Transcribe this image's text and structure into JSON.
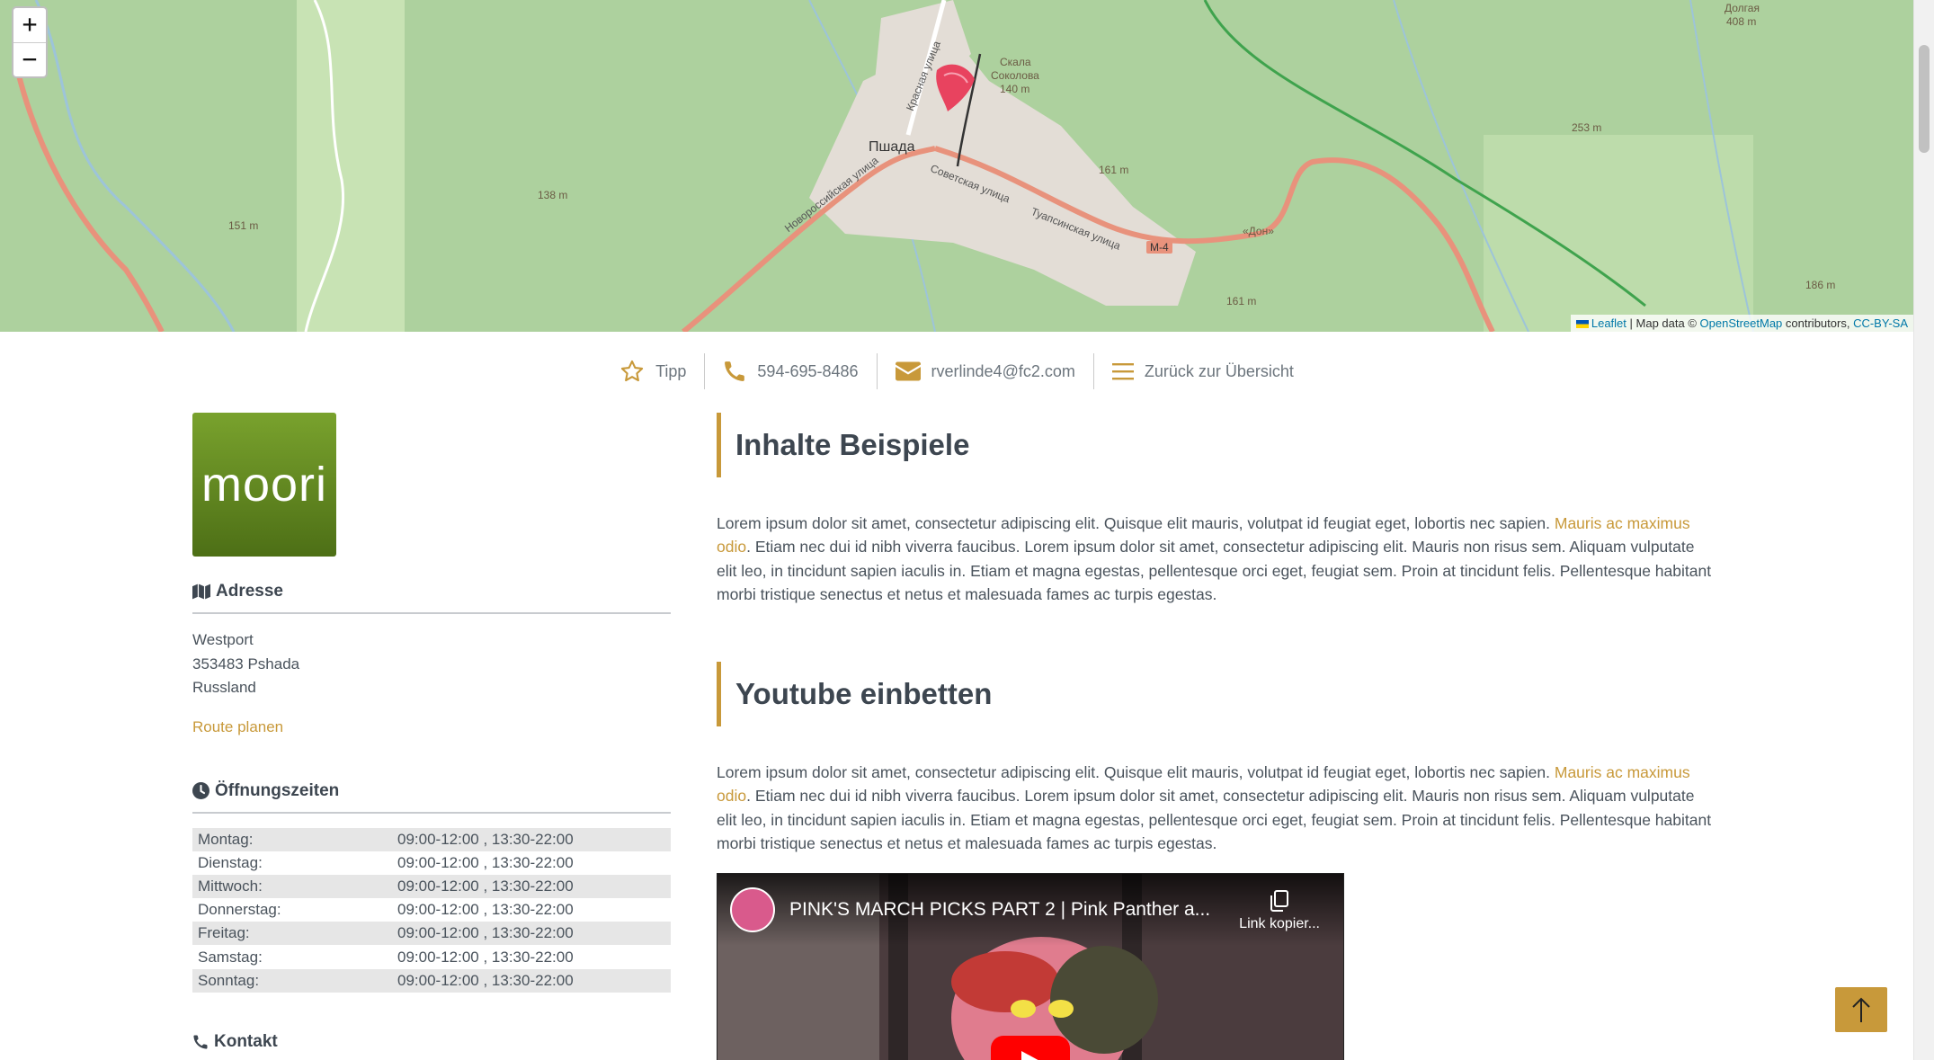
{
  "map": {
    "zoom_in": "+",
    "zoom_out": "−",
    "attribution": {
      "leaflet": "Leaflet",
      "sep": " | Map data © ",
      "osm": "OpenStreetMap",
      "contributors": " contributors, ",
      "license": "CC-BY-SA"
    },
    "labels": {
      "town": "Пшада",
      "rock": "Скала",
      "rock2": "Соколова",
      "rock_h": "140 m",
      "street1": "Новороссийская улица",
      "street2": "Советская улица",
      "street3": "Туапсинская улица",
      "street4": "Красная улица",
      "road": "M-4",
      "don": "«Дон»",
      "h1": "161 m",
      "h2": "138 m",
      "h3": "151 m",
      "h4": "253 m",
      "h5": "186 m",
      "h6": "161 m",
      "h7": "Долгая",
      "h7b": "408 m"
    }
  },
  "nav": {
    "tip": "Tipp",
    "phone": "594-695-8486",
    "email": "rverlinde4@fc2.com",
    "back": "Zurück zur Übersicht"
  },
  "sidebar": {
    "logo_text": "moori",
    "address_heading": "Adresse",
    "address_lines": [
      "Westport",
      "353483 Pshada",
      "Russland"
    ],
    "route_label": "Route planen",
    "hours_heading": "Öffnungszeiten",
    "hours": [
      {
        "day": "Montag:",
        "time": "09:00-12:00 , 13:30-22:00"
      },
      {
        "day": "Dienstag:",
        "time": "09:00-12:00 , 13:30-22:00"
      },
      {
        "day": "Mittwoch:",
        "time": "09:00-12:00 , 13:30-22:00"
      },
      {
        "day": "Donnerstag:",
        "time": "09:00-12:00 , 13:30-22:00"
      },
      {
        "day": "Freitag:",
        "time": "09:00-12:00 , 13:30-22:00"
      },
      {
        "day": "Samstag:",
        "time": "09:00-12:00 , 13:30-22:00"
      },
      {
        "day": "Sonntag:",
        "time": "09:00-12:00 , 13:30-22:00"
      }
    ],
    "contact_heading": "Kontakt"
  },
  "main": {
    "section1_title": "Inhalte Beispiele",
    "section1_text_a": "Lorem ipsum dolor sit amet, consectetur adipiscing elit. Quisque elit mauris, volutpat id feugiat eget, lobortis nec sapien. ",
    "section1_link": "Mauris ac maximus odio",
    "section1_text_b": ". Etiam nec dui id nibh viverra faucibus. Lorem ipsum dolor sit amet, consectetur adipiscing elit. Mauris non risus sem. Aliquam vulputate elit leo, in tincidunt sapien iaculis in. Etiam et magna egestas, pellentesque orci eget, feugiat sem. Proin at tincidunt felis. Pellentesque habitant morbi tristique senectus et netus et malesuada fames ac turpis egestas.",
    "section2_title": "Youtube einbetten",
    "section2_text_a": "Lorem ipsum dolor sit amet, consectetur adipiscing elit. Quisque elit mauris, volutpat id feugiat eget, lobortis nec sapien. ",
    "section2_link": "Mauris ac maximus odio",
    "section2_text_b": ". Etiam nec dui id nibh viverra faucibus. Lorem ipsum dolor sit amet, consectetur adipiscing elit. Mauris non risus sem. Aliquam vulputate elit leo, in tincidunt sapien iaculis in. Etiam et magna egestas, pellentesque orci eget, feugiat sem. Proin at tincidunt felis. Pellentesque habitant morbi tristique senectus et netus et malesuada fames ac turpis egestas.",
    "video": {
      "title": "PINK'S MARCH PICKS PART 2 | Pink Panther a...",
      "copy_label": "Link kopier..."
    }
  },
  "colors": {
    "accent": "#c8993a",
    "map_green": "#a8d596",
    "road": "#e8927c",
    "marker": "#e8435f"
  },
  "icons": {
    "tip": "star-icon",
    "phone": "phone-icon",
    "email": "envelope-icon",
    "back": "list-icon",
    "address": "map-icon",
    "hours": "clock-icon",
    "contact": "phone-icon",
    "to_top": "arrow-up-icon"
  }
}
